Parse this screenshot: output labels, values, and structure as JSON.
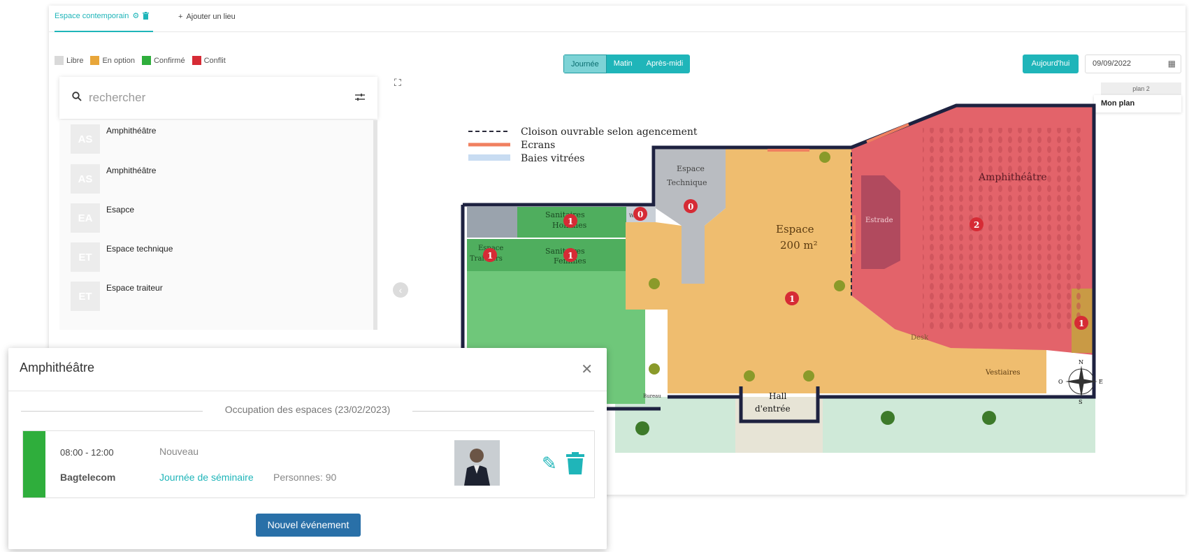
{
  "tabs": {
    "active_label": "Espace contemporain",
    "add_label": "Ajouter un lieu"
  },
  "legend": [
    {
      "label": "Libre",
      "color": "#d9d9d9"
    },
    {
      "label": "En option",
      "color": "#e8a63a"
    },
    {
      "label": "Confirmé",
      "color": "#2fae3c"
    },
    {
      "label": "Conflit",
      "color": "#d62b35"
    }
  ],
  "period": {
    "options": [
      "Journée",
      "Matin",
      "Après-midi"
    ],
    "selected": "Journée"
  },
  "date": {
    "today_label": "Aujourd'hui",
    "value": "09/09/2022"
  },
  "plans": {
    "header": "plan 2",
    "items": [
      "Mon plan"
    ]
  },
  "search": {
    "placeholder": "rechercher"
  },
  "spaces": [
    {
      "initials": "AS",
      "name": "Amphithéâtre"
    },
    {
      "initials": "AS",
      "name": "Amphithéâtre"
    },
    {
      "initials": "EA",
      "name": "Esapce"
    },
    {
      "initials": "ET",
      "name": "Espace technique"
    },
    {
      "initials": "ET",
      "name": "Espace traiteur"
    }
  ],
  "floorplan": {
    "legend": [
      {
        "label": "Cloison ouvrable selon agencement"
      },
      {
        "label": "Ecrans"
      },
      {
        "label": "Baies vitrées"
      }
    ],
    "rooms": {
      "amphi": "Amphithéâtre",
      "estrade": "Estrade",
      "espace": "Espace",
      "espace_size": "200 m²",
      "tech_1": "Espace",
      "tech_2": "Technique",
      "san_h_1": "Sanitaires",
      "san_h_2": "Hommes",
      "san_f_1": "Sanitaires",
      "san_f_2": "Femmes",
      "traiteur_1": "Espace",
      "traiteur_2": "Traiteurs",
      "desk": "Desk",
      "vestiaires": "Vestiaires",
      "hall_1": "Hall",
      "hall_2": "d'entrée",
      "bureau": "Bureau",
      "wc": "W.C."
    },
    "compass": {
      "n": "N",
      "s": "S",
      "e": "E",
      "o": "O"
    },
    "markers": [
      "1",
      "1",
      "1",
      "0",
      "0",
      "1",
      "2",
      "1"
    ],
    "colors": {
      "occupied_espace": "#efbd6f",
      "conflict": "#e3636a",
      "confirmed": "#6fc77a",
      "free": "#b9bcc1"
    }
  },
  "modal": {
    "title": "Amphithéâtre",
    "occupation_label": "Occupation des espaces (23/02/2023)",
    "event": {
      "time": "08:00 - 12:00",
      "status": "Nouveau",
      "client": "Bagtelecom",
      "type": "Journée de séminaire",
      "people": "Personnes: 90",
      "status_color": "#2fae3c"
    },
    "new_event_label": "Nouvel événement"
  }
}
